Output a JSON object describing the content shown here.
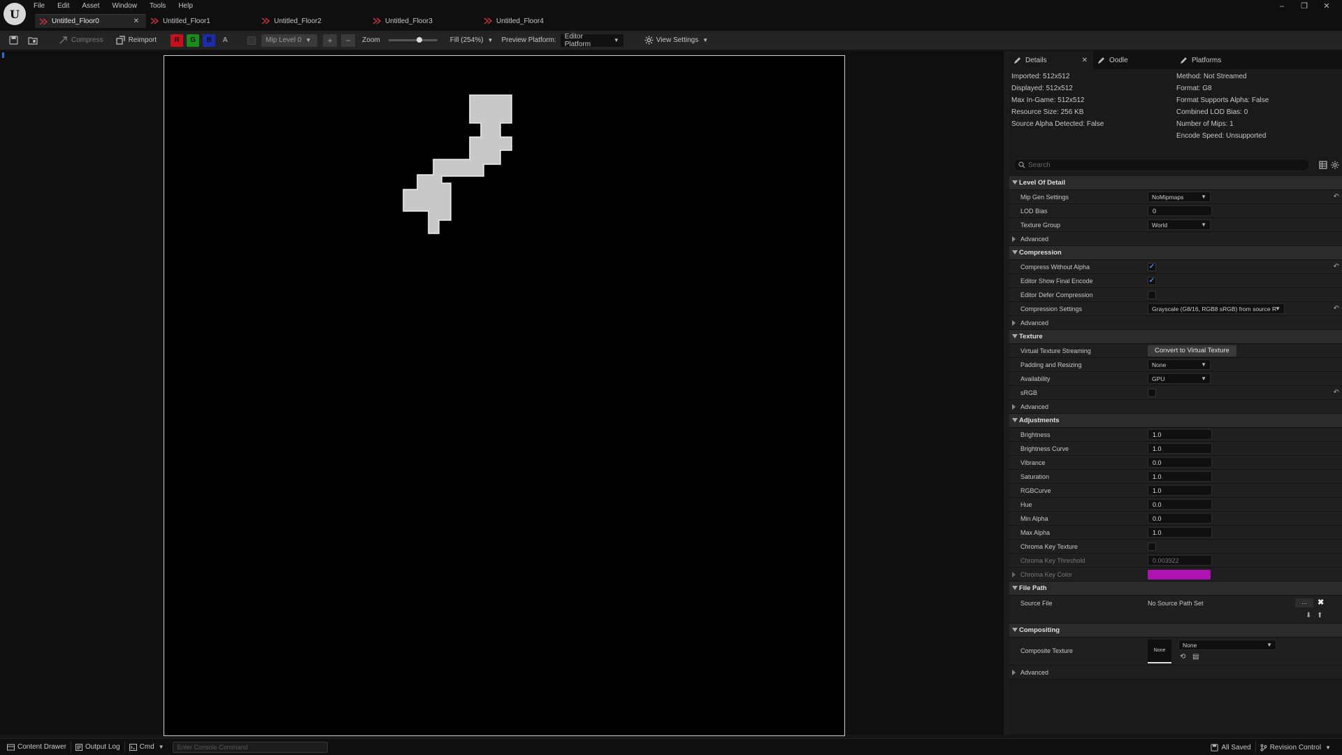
{
  "menu": [
    "File",
    "Edit",
    "Asset",
    "Window",
    "Tools",
    "Help"
  ],
  "tabs": [
    {
      "label": "Untitled_Floor0",
      "active": true
    },
    {
      "label": "Untitled_Floor1",
      "active": false
    },
    {
      "label": "Untitled_Floor2",
      "active": false
    },
    {
      "label": "Untitled_Floor3",
      "active": false
    },
    {
      "label": "Untitled_Floor4",
      "active": false
    }
  ],
  "toolbar": {
    "compress": "Compress",
    "reimport": "Reimport",
    "channels": [
      "R",
      "G",
      "B",
      "A"
    ],
    "mip_level": "Mip Level 0",
    "zoom_label": "Zoom",
    "zoom_level": 0.65,
    "fill": "Fill (254%)",
    "preview_platform_label": "Preview Platform:",
    "preview_platform": "Editor Platform",
    "view_settings": "View Settings"
  },
  "panel_tabs": {
    "details": "Details",
    "oodle": "Oodle",
    "platforms": "Platforms"
  },
  "info": {
    "left": [
      "Imported: 512x512",
      "Displayed: 512x512",
      "Max In-Game: 512x512",
      "Resource Size: 256 KB",
      "Source Alpha Detected: False"
    ],
    "right": [
      "Method: Not Streamed",
      "Format: G8",
      "Format Supports Alpha: False",
      "Combined LOD Bias: 0",
      "Number of Mips: 1",
      "Encode Speed: Unsupported"
    ]
  },
  "search": {
    "placeholder": "Search"
  },
  "sections": {
    "level_of_detail": "Level Of Detail",
    "compression": "Compression",
    "texture": "Texture",
    "adjustments": "Adjustments",
    "file_path": "File Path",
    "compositing": "Compositing"
  },
  "advanced": "Advanced",
  "props": {
    "mip_gen_settings": {
      "name": "Mip Gen Settings",
      "value": "NoMipmaps"
    },
    "lod_bias": {
      "name": "LOD Bias",
      "value": "0"
    },
    "texture_group": {
      "name": "Texture Group",
      "value": "World"
    },
    "compress_without_alpha": {
      "name": "Compress Without Alpha",
      "checked": true
    },
    "editor_show_final_encode": {
      "name": "Editor Show Final Encode",
      "checked": true
    },
    "editor_defer_compression": {
      "name": "Editor Defer Compression",
      "checked": false
    },
    "compression_settings": {
      "name": "Compression Settings",
      "value": "Grayscale (G8/16, RGB8 sRGB) from source R"
    },
    "virtual_texture_streaming": {
      "name": "Virtual Texture Streaming",
      "button": "Convert to Virtual Texture"
    },
    "padding_and_resizing": {
      "name": "Padding and Resizing",
      "value": "None"
    },
    "availability": {
      "name": "Availability",
      "value": "GPU"
    },
    "srgb": {
      "name": "sRGB",
      "checked": false
    },
    "brightness": {
      "name": "Brightness",
      "value": "1.0"
    },
    "brightness_curve": {
      "name": "Brightness Curve",
      "value": "1.0"
    },
    "vibrance": {
      "name": "Vibrance",
      "value": "0.0"
    },
    "saturation": {
      "name": "Saturation",
      "value": "1.0"
    },
    "rgbcurve": {
      "name": "RGBCurve",
      "value": "1.0"
    },
    "hue": {
      "name": "Hue",
      "value": "0.0"
    },
    "min_alpha": {
      "name": "Min Alpha",
      "value": "0.0"
    },
    "max_alpha": {
      "name": "Max Alpha",
      "value": "1.0"
    },
    "chroma_key_texture": {
      "name": "Chroma Key Texture",
      "checked": false
    },
    "chroma_key_threshold": {
      "name": "Chroma Key Threshold",
      "value": "0.003922"
    },
    "chroma_key_color": {
      "name": "Chroma Key Color",
      "color": "#ae14b1"
    },
    "source_file": {
      "name": "Source File",
      "value": "No Source Path Set",
      "browse": "..."
    },
    "composite_texture": {
      "name": "Composite Texture",
      "thumb": "None",
      "value": "None"
    }
  },
  "statusbar": {
    "content_drawer": "Content Drawer",
    "output_log": "Output Log",
    "cmd": "Cmd",
    "console_placeholder": "Enter Console Command",
    "all_saved": "All Saved",
    "revision_control": "Revision Control"
  },
  "colors": {
    "accent": "#2c6fd9",
    "channel_r": "#c8101a",
    "channel_g": "#1a8c1a",
    "channel_b": "#1d2ba8",
    "chroma_key": "#ae14b1"
  }
}
